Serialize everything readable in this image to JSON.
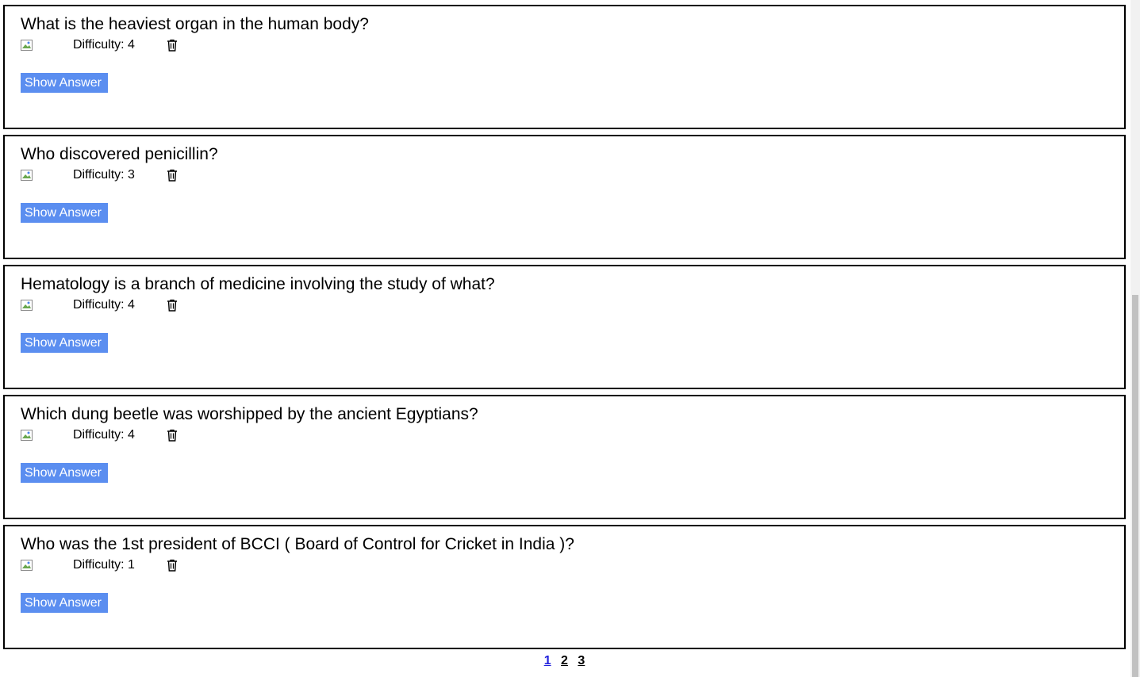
{
  "questions": [
    {
      "text": "What is the heaviest organ in the human body?",
      "difficulty": "Difficulty: 4",
      "button": "Show Answer"
    },
    {
      "text": "Who discovered penicillin?",
      "difficulty": "Difficulty: 3",
      "button": "Show Answer"
    },
    {
      "text": "Hematology is a branch of medicine involving the study of what?",
      "difficulty": "Difficulty: 4",
      "button": "Show Answer"
    },
    {
      "text": "Which dung beetle was worshipped by the ancient Egyptians?",
      "difficulty": "Difficulty: 4",
      "button": "Show Answer"
    },
    {
      "text": "Who was the 1st president of BCCI ( Board of Control for Cricket in India )?",
      "difficulty": "Difficulty: 1",
      "button": "Show Answer"
    }
  ],
  "pagination": {
    "pages": [
      "1",
      "2",
      "3"
    ],
    "current": "1"
  },
  "icons": {
    "image": "broken-image-icon",
    "delete": "trash-icon"
  },
  "colors": {
    "button_bg": "#5b8ef0",
    "active_page": "#2222dd"
  }
}
